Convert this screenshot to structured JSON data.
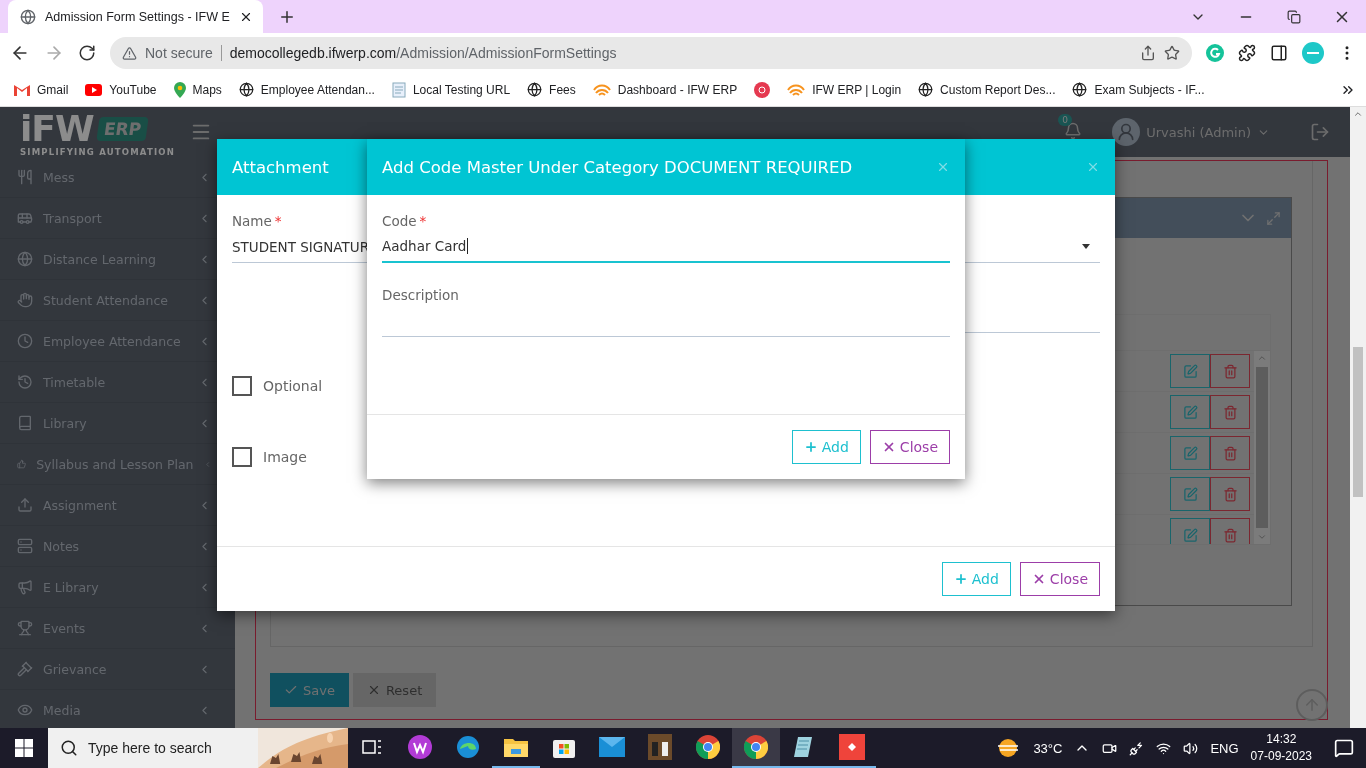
{
  "browser": {
    "tab_title": "Admission Form Settings - IFW E",
    "security": "Not secure",
    "url_host": "democollegedb.ifwerp.com",
    "url_path": "/Admission/AdmissionFormSettings",
    "bookmarks": [
      {
        "kind": "gmail",
        "label": "Gmail"
      },
      {
        "kind": "youtube",
        "label": "YouTube"
      },
      {
        "kind": "maps",
        "label": "Maps"
      },
      {
        "kind": "globe",
        "label": "Employee Attendan..."
      },
      {
        "kind": "document",
        "label": "Local Testing URL"
      },
      {
        "kind": "globe",
        "label": "Fees"
      },
      {
        "kind": "swirl",
        "label": "Dashboard - IFW ERP"
      },
      {
        "kind": "target"
      },
      {
        "kind": "swirl",
        "label": "IFW ERP | Login"
      },
      {
        "kind": "globe",
        "label": "Custom Report Des..."
      },
      {
        "kind": "globe",
        "label": "Exam Subjects - IF..."
      }
    ]
  },
  "app": {
    "logo": {
      "brand": "iFW",
      "badge": "ERP",
      "tagline": "SIMPLIFYING AUTOMATION"
    },
    "sidebar": {
      "items": [
        {
          "label": "Mess"
        },
        {
          "label": "Transport"
        },
        {
          "label": "Distance Learning"
        },
        {
          "label": "Student Attendance"
        },
        {
          "label": "Employee Attendance"
        },
        {
          "label": "Timetable"
        },
        {
          "label": "Library"
        },
        {
          "label": "Syllabus and Lesson Plan"
        },
        {
          "label": "Assignment"
        },
        {
          "label": "Notes"
        },
        {
          "label": "E Library"
        },
        {
          "label": "Events"
        },
        {
          "label": "Grievance"
        },
        {
          "label": "Media"
        }
      ]
    },
    "header": {
      "notifications": "0",
      "user": "Urvashi (Admin)"
    },
    "table": {
      "rows": [
        {
          "kind": "editable"
        },
        {
          "kind": "editable"
        },
        {
          "kind": "editable"
        },
        {
          "kind": "editable"
        },
        {
          "kind": "editable"
        }
      ]
    },
    "buttons": {
      "save": "Save",
      "reset": "Reset"
    }
  },
  "attachment_modal": {
    "title": "Attachment",
    "name_label": "Name",
    "name_required": "*",
    "name_value": "STUDENT SIGNATUR",
    "checkboxes": [
      {
        "label": "Optional",
        "checked": false
      },
      {
        "label": "Image",
        "checked": false
      }
    ],
    "add": "Add",
    "close": "Close"
  },
  "code_modal": {
    "title": "Add Code Master Under Category DOCUMENT REQUIRED",
    "fields": [
      {
        "label": "Code",
        "required_mark": "*",
        "value": "Aadhar Card",
        "focused": true
      },
      {
        "label": "Description",
        "focused": false
      }
    ],
    "add": "Add",
    "close": "Close"
  },
  "taskbar": {
    "search_placeholder": "Type here to search",
    "temperature": "33°C",
    "language": "ENG",
    "time": "14:32",
    "date": "07-09-2023",
    "apps": [
      {
        "kind": "taskview",
        "running": false,
        "active": false
      },
      {
        "kind": "wps",
        "running": false,
        "active": false
      },
      {
        "kind": "edge",
        "running": false,
        "active": false
      },
      {
        "kind": "folder",
        "running": true,
        "active": false
      },
      {
        "kind": "store",
        "running": false,
        "active": false
      },
      {
        "kind": "mail",
        "running": false,
        "active": false
      },
      {
        "kind": "game",
        "running": false,
        "active": false
      },
      {
        "kind": "chrome",
        "running": false,
        "active": false
      },
      {
        "kind": "chrome",
        "running": true,
        "active": true
      },
      {
        "kind": "notepad",
        "running": true,
        "active": false
      },
      {
        "kind": "remote",
        "running": true,
        "active": false
      }
    ]
  }
}
